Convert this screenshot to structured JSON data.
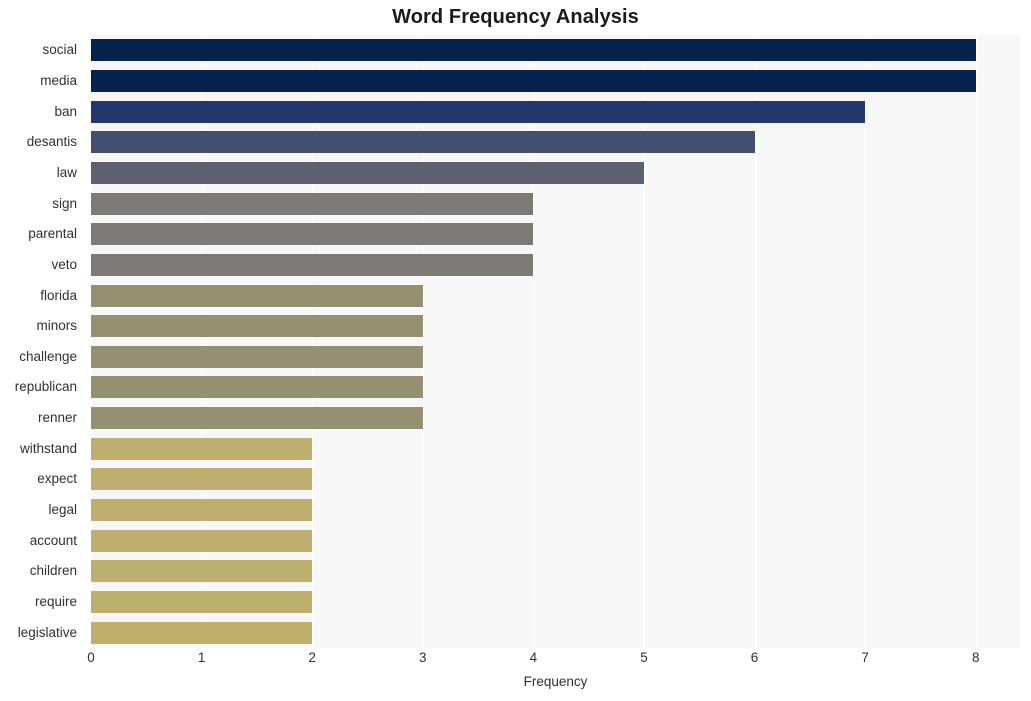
{
  "chart_data": {
    "type": "bar",
    "orientation": "horizontal",
    "title": "Word Frequency Analysis",
    "xlabel": "Frequency",
    "ylabel": "",
    "xlim": [
      0,
      8.4
    ],
    "xticks": [
      0,
      1,
      2,
      3,
      4,
      5,
      6,
      7,
      8
    ],
    "xtick_labels": [
      "0",
      "1",
      "2",
      "3",
      "4",
      "5",
      "6",
      "7",
      "8"
    ],
    "grid": "vertical-white-on-light-gray",
    "legend": "none",
    "categories": [
      "social",
      "media",
      "ban",
      "desantis",
      "law",
      "sign",
      "parental",
      "veto",
      "florida",
      "minors",
      "challenge",
      "republican",
      "renner",
      "withstand",
      "expect",
      "legal",
      "account",
      "children",
      "require",
      "legislative"
    ],
    "values": [
      8,
      8,
      7,
      6,
      5,
      4,
      4,
      4,
      3,
      3,
      3,
      3,
      3,
      2,
      2,
      2,
      2,
      2,
      2,
      2
    ],
    "bar_colors": [
      "#06234d",
      "#06234d",
      "#21376e",
      "#424f70",
      "#5c6070",
      "#7b7a77",
      "#7b7a77",
      "#7b7a77",
      "#969073",
      "#969073",
      "#969073",
      "#969073",
      "#969073",
      "#bfaf6e",
      "#bfaf6e",
      "#bfaf6e",
      "#bfaf6e",
      "#bfaf6e",
      "#bfaf6e",
      "#bfaf6e"
    ],
    "plot_background": "#f7f7f7",
    "figure_background": "#ffffff",
    "title_color": "#1a1a1a",
    "tick_color": "#303030"
  }
}
